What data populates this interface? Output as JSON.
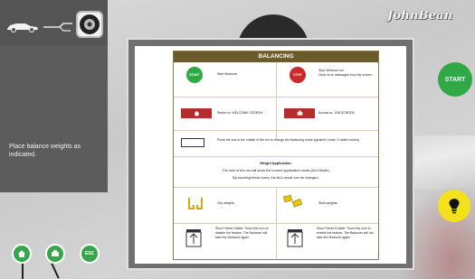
{
  "header": {
    "logo": "JohnBean"
  },
  "left_panel": {
    "message": "Place balance weights as indicated."
  },
  "buttons": {
    "start": "START",
    "esc": "ESC"
  },
  "colors": {
    "green": "#2fa845",
    "yellow": "#f3e21b",
    "doc_header": "#6b5a2c",
    "red": "#b52c2c"
  },
  "dialog": {
    "title": "BALANCING",
    "rows": [
      {
        "left": {
          "icon": "START",
          "text": "Start Measure."
        },
        "right": {
          "icon": "STOP",
          "text": "Stop Measure run.\nClear error messages from the screen."
        }
      },
      {
        "left": {
          "icon": "home-icon",
          "text": "Return to: WELCOME SCREEN."
        },
        "right": {
          "icon": "printer-icon",
          "text": "Access to: JOB SCREEN."
        }
      }
    ],
    "mode_text": "Press the box in the middle of the rim to change the balancing mode (dynamic mode / 2 static modes).",
    "weight_application": {
      "heading": "Weight Application:",
      "line1": "The rims of the rim will show the current application mode (ALU Mode).",
      "line2": "By touching these icons, the ALU mode can be changed."
    },
    "weights": {
      "clip": "Clip weights.",
      "stick": "Stick weights."
    },
    "stabilizer": {
      "left": "Slow Freeze Stable: Touch the icon to disable the feature. The Balancer will start the Measure again.",
      "right": "Slow Freeze Enable: Touch the icon to enable the feature. The Balancer will not take the Measure again."
    }
  }
}
